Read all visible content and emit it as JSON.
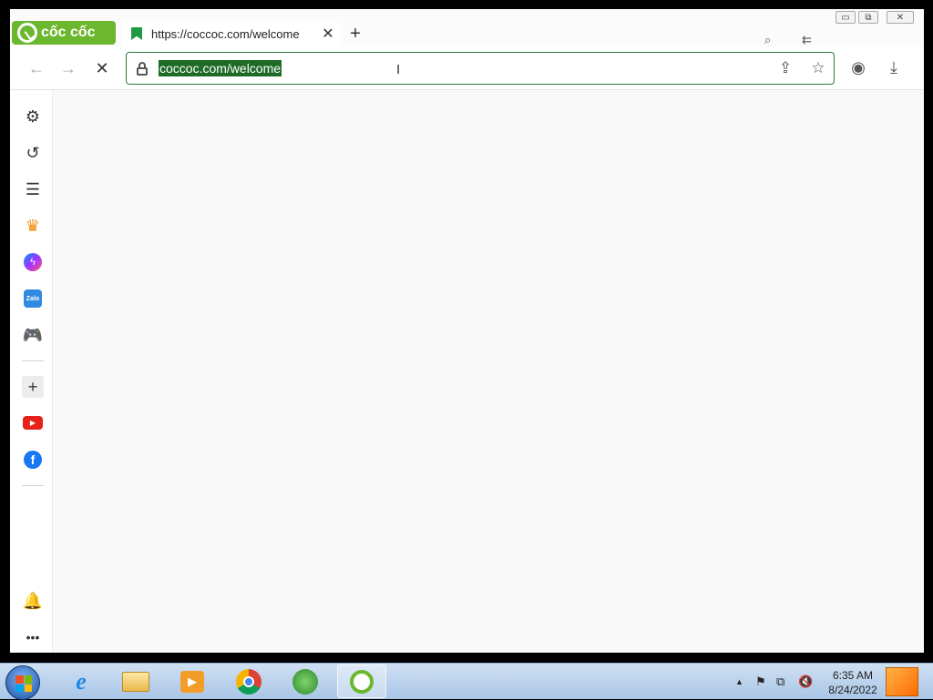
{
  "browser": {
    "brand_label": "cốc cốc",
    "tab": {
      "title": "https://coccoc.com/welcome",
      "close": "✕"
    },
    "new_tab": "+",
    "window_controls": {
      "minimize": "▭",
      "restore": "⧉",
      "close": "✕"
    },
    "nav": {
      "back": "←",
      "forward": "→",
      "stop": "✕"
    },
    "address": {
      "url": "coccoc.com/welcome"
    },
    "toolbar_icons": {
      "share": "⇪",
      "bookmark": "☆",
      "profile": "◉",
      "download": "⤓"
    }
  },
  "sidebar": {
    "items": [
      {
        "name": "settings",
        "glyph": "⚙"
      },
      {
        "name": "history",
        "glyph": "↺"
      },
      {
        "name": "reading-list",
        "glyph": "☰"
      },
      {
        "name": "crown",
        "glyph": "♛"
      },
      {
        "name": "messenger",
        "glyph": "ϟ"
      },
      {
        "name": "zalo",
        "glyph": "Zalo"
      },
      {
        "name": "games",
        "glyph": "🎮"
      },
      {
        "name": "add",
        "glyph": "+"
      },
      {
        "name": "youtube",
        "glyph": "▶"
      },
      {
        "name": "facebook",
        "glyph": "f"
      },
      {
        "name": "notifications",
        "glyph": "🔔"
      },
      {
        "name": "more",
        "glyph": "•••"
      }
    ]
  },
  "taskbar": {
    "apps": [
      "internet-explorer",
      "file-explorer",
      "media-player",
      "chrome",
      "windows-update",
      "coccoc"
    ],
    "tray": {
      "arrow": "▲",
      "flag": "⚑",
      "network": "⧉",
      "volume": "🔇"
    },
    "clock": {
      "time": "6:35 AM",
      "date": "8/24/2022"
    }
  }
}
